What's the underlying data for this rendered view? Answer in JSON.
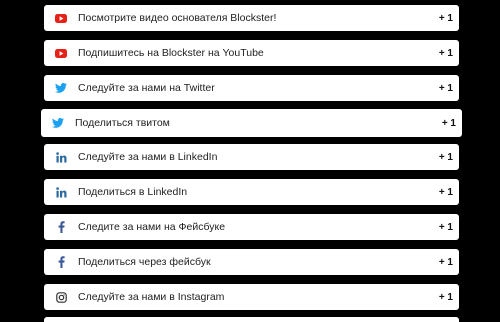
{
  "tasks": [
    {
      "label": "Посмотрите видео основателя Blockster!",
      "points": "+ 1",
      "icon": "youtube-icon"
    },
    {
      "label": "Подпишитесь на Blockster на YouTube",
      "points": "+ 1",
      "icon": "youtube-icon"
    },
    {
      "label": "Следуйте за нами на Twitter",
      "points": "+ 1",
      "icon": "twitter-icon"
    },
    {
      "label": "Поделиться твитом",
      "points": "+ 1",
      "icon": "twitter-icon"
    },
    {
      "label": "Следуйте за нами в LinkedIn",
      "points": "+ 1",
      "icon": "linkedin-icon"
    },
    {
      "label": "Поделиться в LinkedIn",
      "points": "+ 1",
      "icon": "linkedin-icon"
    },
    {
      "label": "Следите за нами на Фейсбуке",
      "points": "+ 1",
      "icon": "facebook-icon"
    },
    {
      "label": "Поделиться через фейсбук",
      "points": "+ 1",
      "icon": "facebook-icon"
    },
    {
      "label": "Следуйте за нами в Instagram",
      "points": "+ 1",
      "icon": "instagram-icon"
    }
  ],
  "colors": {
    "youtube": "#e62117",
    "twitter": "#1da1f2",
    "linkedin": "#2d6a9f",
    "facebook": "#3b5998",
    "instagram": "#333333",
    "background": "#000000"
  }
}
